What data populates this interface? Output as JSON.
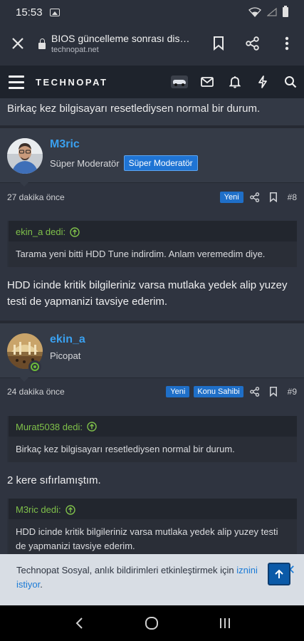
{
  "status_bar": {
    "time": "15:53"
  },
  "browser": {
    "title": "BIOS güncelleme sonrası disk ta...",
    "domain": "technopat.net"
  },
  "site": {
    "logo_text": "TECHNOPAT"
  },
  "top_line": "Birkaç kez bilgisayarı resetlediysen normal bir durum.",
  "posts": [
    {
      "author": "M3ric",
      "role": "Süper Moderatör",
      "role_badge": "Süper Moderatör",
      "time": "27 dakika önce",
      "badge_new": "Yeni",
      "number": "#8",
      "quote_author": "ekin_a dedi:",
      "quote_text": "Tarama yeni bitti HDD Tune indirdim. Anlam veremedim diye.",
      "text": "HDD icinde kritik bilgileriniz varsa mutlaka yedek alip yuzey testi de yapmanizi tavsiye ederim."
    },
    {
      "author": "ekin_a",
      "role": "Picopat",
      "time": "24 dakika önce",
      "badge_new": "Yeni",
      "badge_owner": "Konu Sahibi",
      "number": "#9",
      "quote1_author": "Murat5038 dedi:",
      "quote1_text": "Birkaç kez bilgisayarı resetlediysen normal bir durum.",
      "text": "2 kere sıfırlamıştım.",
      "quote2_author": "M3ric dedi:",
      "quote2_text": "HDD icinde kritik bilgileriniz varsa mutlaka yedek alip yuzey testi de yapmanizi tavsiye ederim."
    }
  ],
  "notification": {
    "text_before": "Technopat Sosyal, anlık bildirimleri etkinleştirmek için ",
    "link_part1": "iznini",
    "link_part2": "istiyor",
    "text_after": "."
  },
  "colors": {
    "accent": "#1f6fc8",
    "username": "#3aa0ef",
    "quote_author": "#7fc04a"
  }
}
